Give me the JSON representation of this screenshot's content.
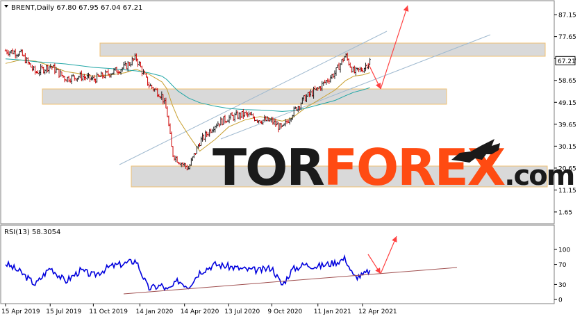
{
  "header": {
    "symbol_line": "BRENT,Daily  67.80 67.95 67.04 67.21",
    "rsi_label": "RSI(13) 58.3054"
  },
  "watermark": {
    "part1": "TOR",
    "part2": "FOREX",
    "part3": ".com",
    "color_dark": "#1a1a1a",
    "color_accent": "#ff4b12"
  },
  "colors": {
    "up": "#1a1a1a",
    "down": "#cc0000",
    "ma_fast": "#c8a030",
    "ma_slow": "#20a6a6",
    "rsi_line": "#0000dd",
    "zone_fill": "#d9d9d9",
    "zone_border": "#f0c070",
    "channel": "#9fb9cf",
    "arrow": "#ff4040",
    "trendline": "#a05050",
    "price_tag_bg": "#ffffff"
  },
  "chart_data": [
    {
      "type": "line",
      "title": "BRENT,Daily",
      "ohlc_last": {
        "open": 67.8,
        "high": 67.95,
        "low": 67.04,
        "close": 67.21
      },
      "last_price_label": "67.21",
      "y_ticks": [
        "87.15",
        "77.65",
        "68.15",
        "58.65",
        "49.15",
        "39.65",
        "30.15",
        "20.65",
        "11.15",
        "1.65"
      ],
      "ylim": [
        1.65,
        92
      ],
      "x_ticks": [
        "15 Apr 2019",
        "15 Jul 2019",
        "11 Oct 2019",
        "14 Jan 2020",
        "14 Apr 2020",
        "13 Jul 2020",
        "9 Oct 2020",
        "11 Jan 2021",
        "12 Apr 2021"
      ],
      "x": [
        "2019-04-15",
        "2019-05-15",
        "2019-06-15",
        "2019-07-15",
        "2019-08-15",
        "2019-09-15",
        "2019-10-11",
        "2019-11-15",
        "2019-12-15",
        "2020-01-06",
        "2020-01-31",
        "2020-02-28",
        "2020-03-09",
        "2020-03-20",
        "2020-04-01",
        "2020-04-22",
        "2020-05-15",
        "2020-06-15",
        "2020-07-13",
        "2020-08-15",
        "2020-09-15",
        "2020-10-09",
        "2020-10-30",
        "2020-11-20",
        "2020-12-15",
        "2021-01-11",
        "2021-02-15",
        "2021-03-08",
        "2021-03-25",
        "2021-04-12",
        "2021-04-27"
      ],
      "series": [
        {
          "values": [
            71.5,
            70.5,
            62.0,
            65.0,
            59.5,
            60.5,
            59.0,
            62.0,
            64.5,
            68.5,
            57.0,
            52.0,
            45.0,
            27.0,
            24.0,
            20.5,
            32.0,
            39.5,
            42.5,
            44.0,
            41.5,
            41.0,
            37.5,
            44.5,
            51.0,
            55.0,
            62.0,
            69.5,
            62.0,
            63.5,
            67.2
          ]
        },
        {
          "values": [
            66.0,
            67.5,
            67.0,
            65.0,
            62.5,
            61.5,
            60.5,
            61.0,
            62.0,
            63.5,
            61.5,
            58.0,
            55.0,
            48.0,
            42.0,
            35.0,
            28.0,
            33.0,
            38.5,
            41.5,
            43.0,
            42.0,
            41.0,
            42.5,
            46.5,
            50.0,
            54.5,
            58.5,
            60.5,
            61.0,
            62.0
          ]
        },
        {
          "values": [
            68.0,
            67.5,
            66.8,
            66.3,
            65.8,
            65.0,
            64.3,
            63.8,
            63.2,
            62.8,
            62.0,
            60.5,
            59.0,
            56.5,
            54.0,
            51.0,
            49.0,
            47.5,
            46.5,
            46.0,
            45.8,
            45.5,
            45.2,
            45.5,
            46.5,
            48.0,
            50.0,
            52.0,
            53.5,
            54.5,
            55.5
          ]
        }
      ]
    },
    {
      "type": "line",
      "title": "RSI(13) 58.3054",
      "y_ticks": [
        "100",
        "70",
        "30",
        "0"
      ],
      "ylim": [
        0,
        100
      ],
      "x": [
        "2019-04-15",
        "2019-05-15",
        "2019-06-15",
        "2019-07-15",
        "2019-08-15",
        "2019-09-15",
        "2019-10-11",
        "2019-11-15",
        "2019-12-15",
        "2020-01-06",
        "2020-01-31",
        "2020-02-28",
        "2020-03-09",
        "2020-03-20",
        "2020-04-01",
        "2020-04-22",
        "2020-05-15",
        "2020-06-15",
        "2020-07-13",
        "2020-08-15",
        "2020-09-15",
        "2020-10-09",
        "2020-10-30",
        "2020-11-20",
        "2020-12-15",
        "2021-01-11",
        "2021-02-15",
        "2021-03-08",
        "2021-03-25",
        "2021-04-12",
        "2021-04-27"
      ],
      "series": [
        {
          "values": [
            72,
            55,
            30,
            64,
            36,
            58,
            48,
            66,
            72,
            78,
            22,
            28,
            18,
            25,
            38,
            26,
            55,
            70,
            66,
            60,
            58,
            64,
            28,
            60,
            70,
            66,
            74,
            82,
            45,
            48,
            58.3
          ]
        }
      ]
    }
  ]
}
